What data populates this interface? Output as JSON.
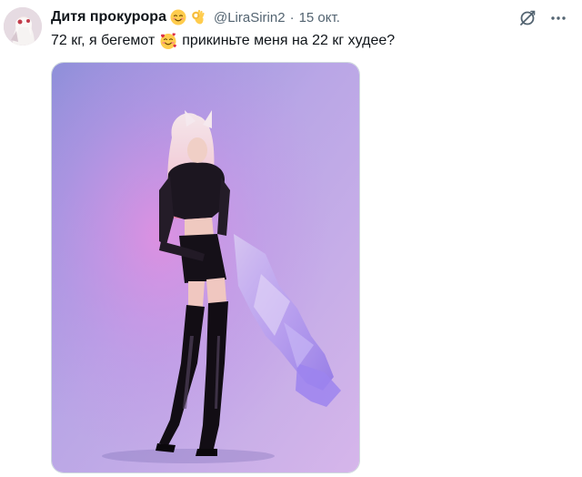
{
  "user": {
    "display_name": "Дитя прокурора",
    "name_emojis": [
      "relieved-face-emoji",
      "ok-hand-emoji"
    ],
    "handle": "@LiraSirin2",
    "separator": "·",
    "date": "15 окт."
  },
  "tweet": {
    "text_before_emoji": "72 кг, я бегемот",
    "text_after_emoji": "прикиньте меня на 22 кг худее?",
    "inline_emoji": "smiling-face-with-hearts-emoji"
  },
  "icons": {
    "grok": "grok-icon",
    "more": "more-icon"
  },
  "colors": {
    "text_primary": "#0f1419",
    "text_secondary": "#536471",
    "border": "#cfd9de",
    "emoji_yellow": "#ffcc4d"
  }
}
